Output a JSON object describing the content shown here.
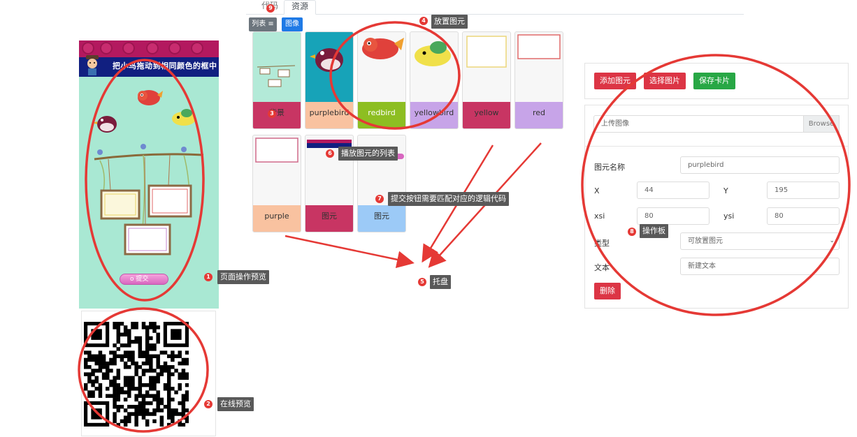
{
  "tabs": {
    "code": "代码",
    "resources": "资源"
  },
  "toolbar": {
    "list_label": "列表 ≡",
    "image_label": "图像"
  },
  "phone": {
    "title": "把小鸟拖动到相同颜色的框中",
    "submit_label": "o 提交"
  },
  "cards": [
    {
      "label": "背景",
      "label_color": "#c83563",
      "text_color": "#333333"
    },
    {
      "label": "purplebird",
      "label_color": "#f9c2a0",
      "text_color": "#333333"
    },
    {
      "label": "redbird",
      "label_color": "#8dbe22",
      "text_color": "#ffffff"
    },
    {
      "label": "yellowbird",
      "label_color": "#c7a4e8",
      "text_color": "#333333"
    },
    {
      "label": "yellow",
      "label_color": "#c83563",
      "text_color": "#333333"
    },
    {
      "label": "red",
      "label_color": "#c7a4e8",
      "text_color": "#333333"
    },
    {
      "label": "purple",
      "label_color": "#f9c2a0",
      "text_color": "#333333"
    },
    {
      "label": "图元",
      "label_color": "#c83563",
      "text_color": "#333333"
    },
    {
      "label": "图元",
      "label_color": "#9ccaf7",
      "text_color": "#333333"
    }
  ],
  "panel": {
    "add_label": "添加图元",
    "select_label": "选择图片",
    "save_label": "保存卡片",
    "upload_placeholder": "上传图像",
    "browse_label": "Browse",
    "name_label": "图元名称",
    "name_value": "purplebird",
    "x_label": "X",
    "x_value": "44",
    "y_label": "Y",
    "y_value": "195",
    "xsi_label": "xsi",
    "xsi_value": "80",
    "ysi_label": "ysi",
    "ysi_value": "80",
    "type_label": "类型",
    "type_value": "可放置图元",
    "text_label": "文本",
    "text_value": "新建文本",
    "delete_label": "删除"
  },
  "annotations": [
    {
      "num": "1",
      "text": "页面操作预览"
    },
    {
      "num": "2",
      "text": "在线预览"
    },
    {
      "num": "3",
      "text": ""
    },
    {
      "num": "4",
      "text": "放置图元"
    },
    {
      "num": "5",
      "text": "托盘"
    },
    {
      "num": "6",
      "text": "播放图元的列表"
    },
    {
      "num": "7",
      "text": "提交按钮需要匹配对应的逻辑代码"
    },
    {
      "num": "8",
      "text": "操作板"
    },
    {
      "num": "9",
      "text": ""
    }
  ],
  "colors": {
    "annotation_red": "#e53935",
    "tooltip_bg": "#595959",
    "danger": "#dc3545",
    "success": "#28a745",
    "primary": "#1f7ae6"
  }
}
